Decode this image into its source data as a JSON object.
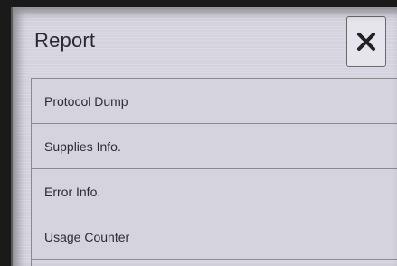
{
  "header": {
    "title": "Report",
    "close_icon": "close-icon"
  },
  "menu": {
    "items": [
      {
        "label": "Protocol Dump"
      },
      {
        "label": "Supplies Info."
      },
      {
        "label": "Error Info."
      },
      {
        "label": "Usage Counter"
      }
    ]
  },
  "colors": {
    "background": "#d9d7e1",
    "text": "#2a2a2e",
    "border": "#8a8a90"
  }
}
